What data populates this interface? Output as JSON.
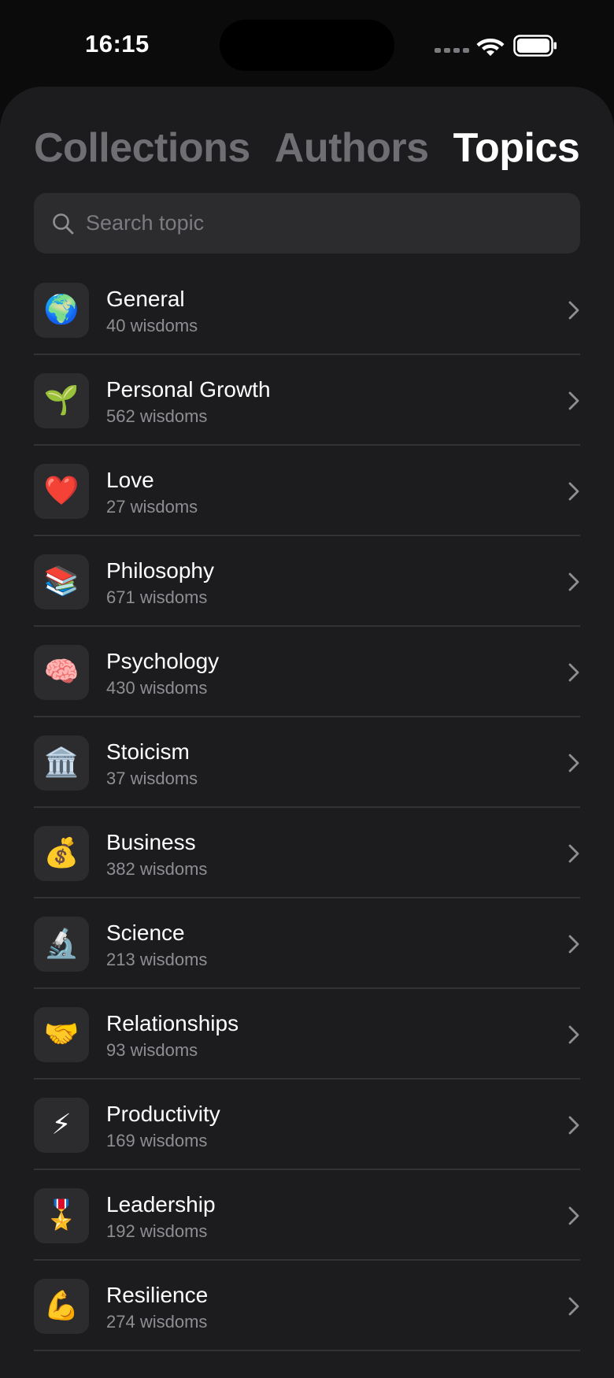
{
  "status_bar": {
    "time": "16:15"
  },
  "tabs": [
    {
      "label": "Collections",
      "active": false
    },
    {
      "label": "Authors",
      "active": false
    },
    {
      "label": "Topics",
      "active": true
    }
  ],
  "search": {
    "placeholder": "Search topic",
    "value": ""
  },
  "topics": [
    {
      "icon": "🌍",
      "icon_name": "globe-icon",
      "name": "General",
      "count": "40 wisdoms"
    },
    {
      "icon": "🌱",
      "icon_name": "seedling-icon",
      "name": "Personal Growth",
      "count": "562 wisdoms"
    },
    {
      "icon": "❤️",
      "icon_name": "heart-icon",
      "name": "Love",
      "count": "27 wisdoms"
    },
    {
      "icon": "📚",
      "icon_name": "books-icon",
      "name": "Philosophy",
      "count": "671 wisdoms"
    },
    {
      "icon": "🧠",
      "icon_name": "brain-icon",
      "name": "Psychology",
      "count": "430 wisdoms"
    },
    {
      "icon": "🏛️",
      "icon_name": "classical-building-icon",
      "name": "Stoicism",
      "count": "37 wisdoms"
    },
    {
      "icon": "💰",
      "icon_name": "money-bag-icon",
      "name": "Business",
      "count": "382 wisdoms"
    },
    {
      "icon": "🔬",
      "icon_name": "microscope-icon",
      "name": "Science",
      "count": "213 wisdoms"
    },
    {
      "icon": "🤝",
      "icon_name": "handshake-icon",
      "name": "Relationships",
      "count": "93 wisdoms"
    },
    {
      "icon": "⚡",
      "icon_name": "lightning-icon",
      "name": "Productivity",
      "count": "169 wisdoms"
    },
    {
      "icon": "🎖️",
      "icon_name": "medal-icon",
      "name": "Leadership",
      "count": "192 wisdoms"
    },
    {
      "icon": "💪",
      "icon_name": "flexed-biceps-icon",
      "name": "Resilience",
      "count": "274 wisdoms"
    }
  ],
  "colors": {
    "background": "#0b0b0c",
    "sheet": "#1c1c1e",
    "tile": "#2c2c2e",
    "secondary_text": "#8e8e93",
    "inactive_tab": "#6f6f73"
  }
}
